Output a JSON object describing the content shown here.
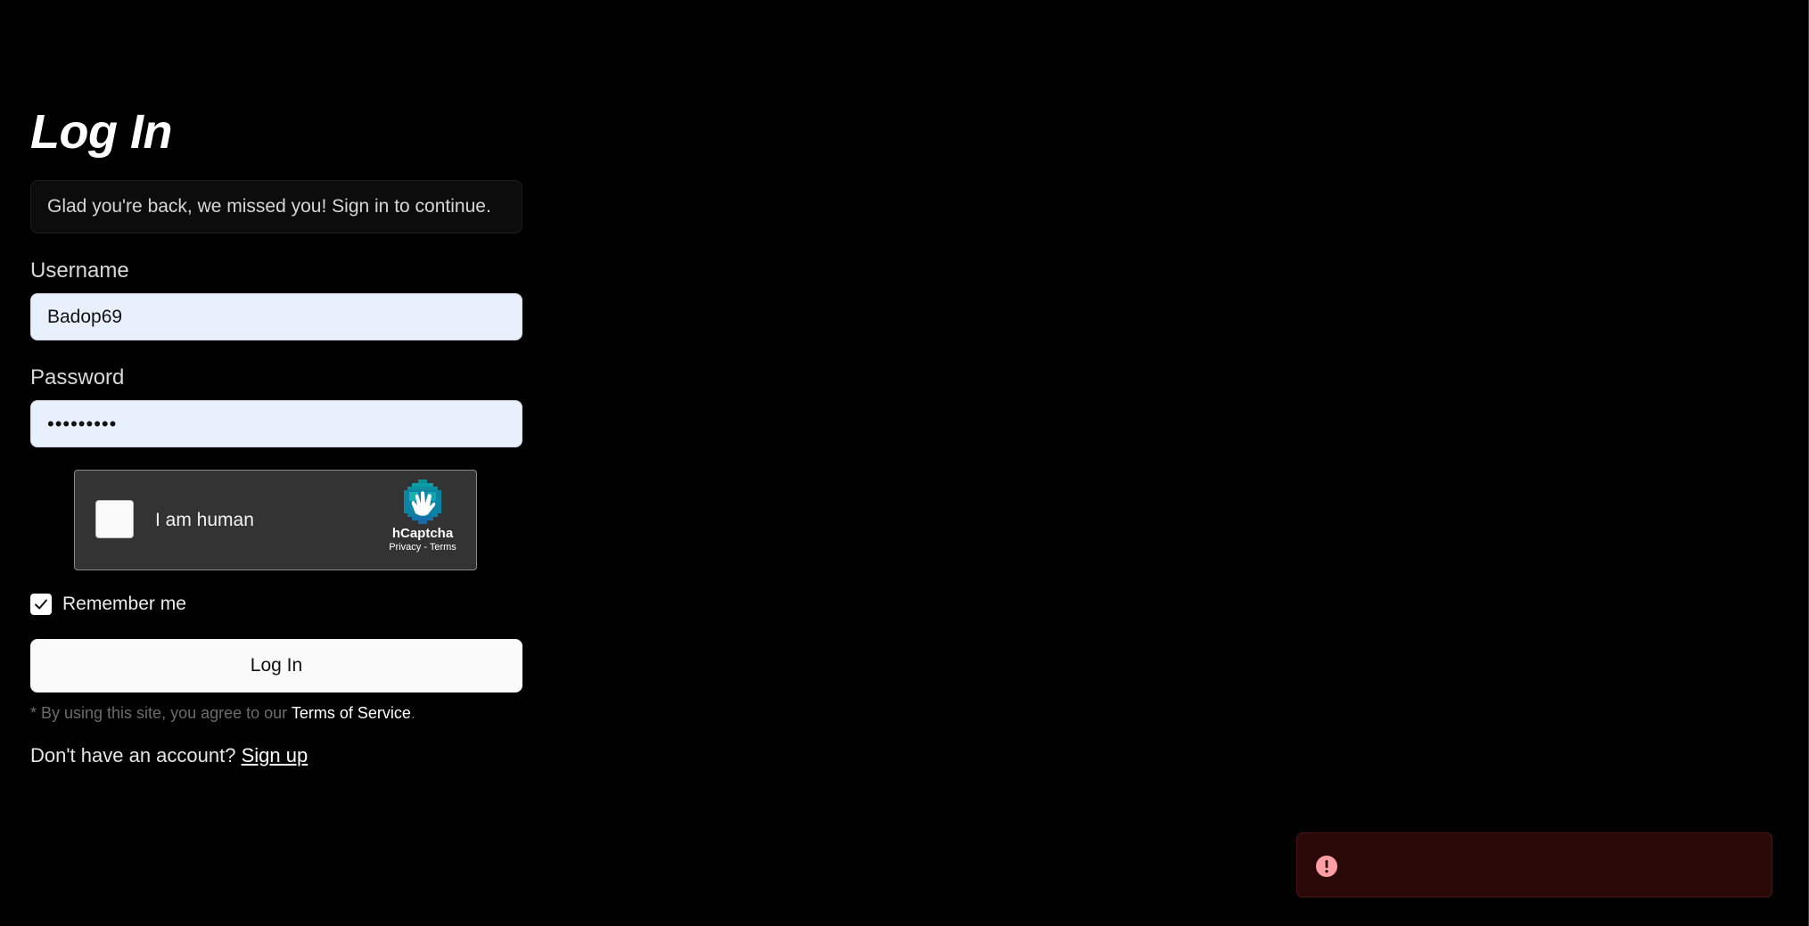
{
  "login": {
    "title": "Log In",
    "welcome_message": "Glad you're back, we missed you! Sign in to continue.",
    "username_label": "Username",
    "username_value": "Badop69",
    "password_label": "Password",
    "password_value": "•••••••••",
    "remember_label": "Remember me",
    "remember_checked": true,
    "login_button_label": "Log In",
    "tos_prefix": "* By using this site, you agree to our ",
    "tos_link": "Terms of Service",
    "tos_suffix": ".",
    "signup_prompt": "Don't have an account? ",
    "signup_link": "Sign up"
  },
  "captcha": {
    "label": "I am human",
    "brand": "hCaptcha",
    "privacy_link": "Privacy",
    "separator": " - ",
    "terms_link": "Terms",
    "logo_icon": "hcaptcha-hand-icon"
  },
  "toast": {
    "type": "error",
    "icon": "alert-circle-icon",
    "icon_color": "#ff9ea3",
    "background_color": "#2b0808"
  },
  "colors": {
    "background": "#000000",
    "input_background": "#e8f0fe",
    "button_background": "#fafafa"
  }
}
